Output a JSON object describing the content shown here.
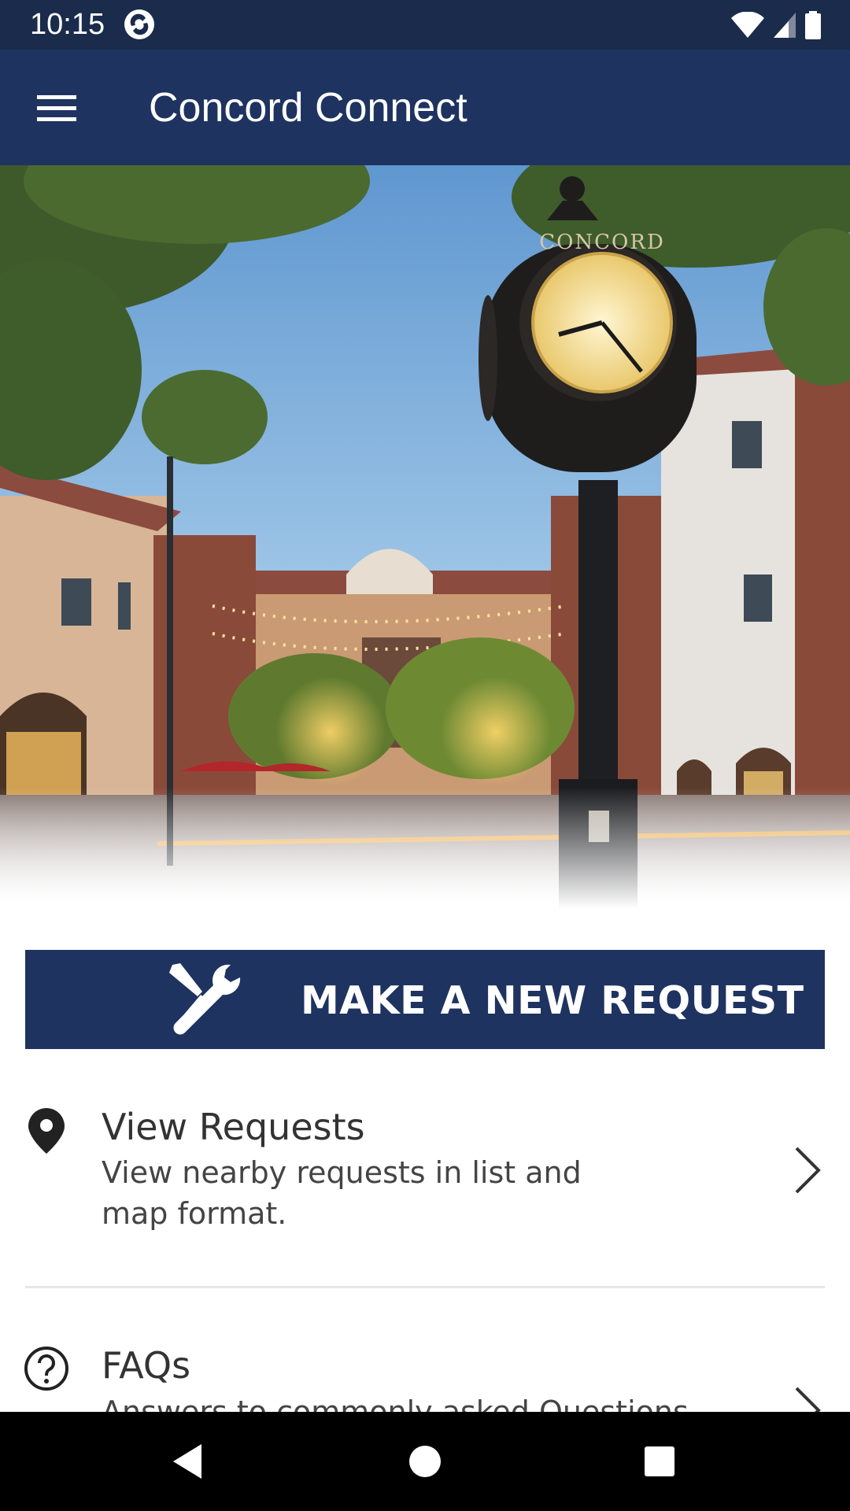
{
  "status_bar": {
    "time": "10:15"
  },
  "app_bar": {
    "title": "Concord Connect"
  },
  "hero": {
    "clock_sign": "CONCORD"
  },
  "request_button": {
    "label": "MAKE A NEW REQUEST"
  },
  "list": {
    "items": [
      {
        "title": "View Requests",
        "description": "View nearby requests in list and map format.",
        "icon": "location-pin-icon"
      },
      {
        "title": "FAQs",
        "description": "Answers to commonly asked Questions",
        "icon": "help-circle-icon"
      }
    ]
  },
  "colors": {
    "status_bar": "#1b2b4b",
    "brand_navy": "#1e3360",
    "text_dark": "#333333"
  }
}
